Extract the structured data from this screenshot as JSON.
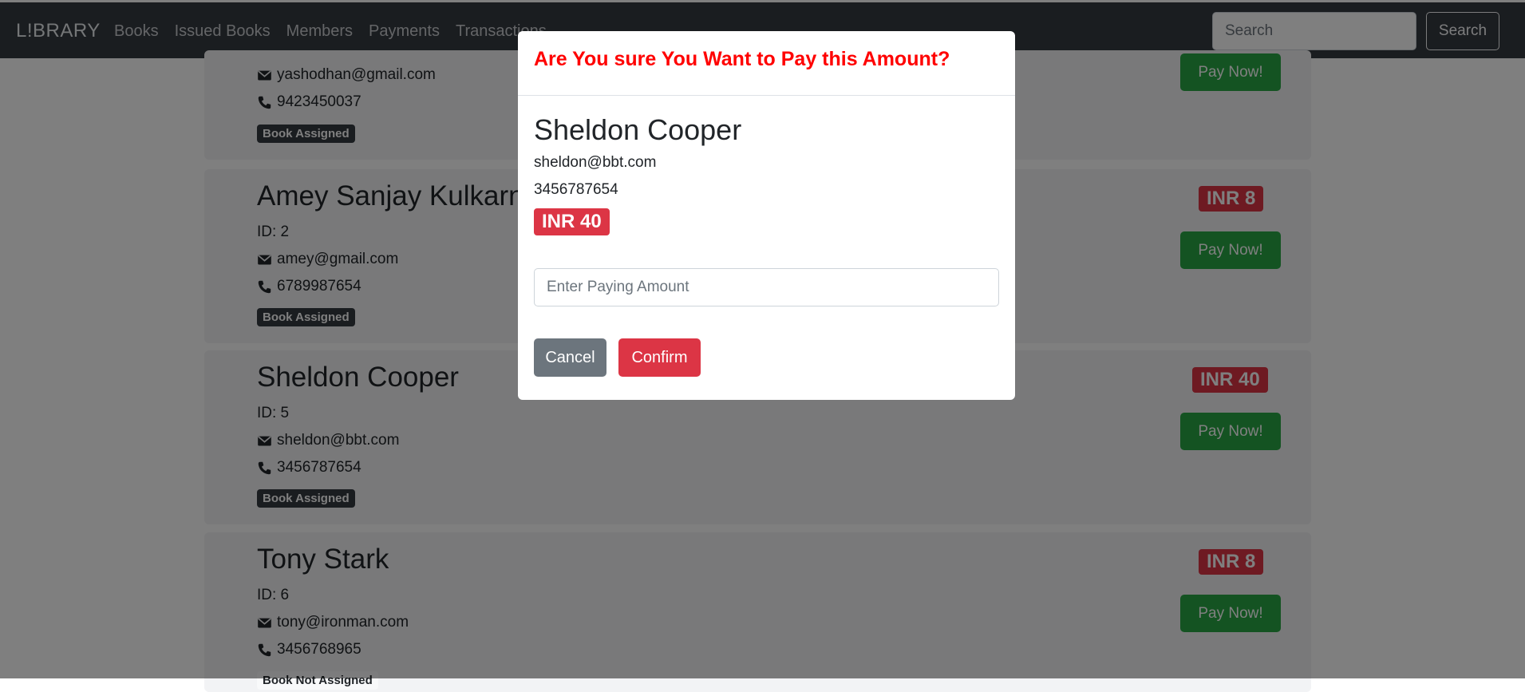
{
  "navbar": {
    "brand": "L!BRARY",
    "links": [
      "Books",
      "Issued Books",
      "Members",
      "Payments",
      "Transactions"
    ],
    "search_placeholder": "Search",
    "search_button": "Search"
  },
  "members": [
    {
      "name": "",
      "id": "",
      "email": "yashodhan@gmail.com",
      "phone": "9423450037",
      "status": "Book Assigned",
      "amount": "",
      "pay_label": "Pay Now!"
    },
    {
      "name": "Amey Sanjay Kulkarn",
      "id": "ID: 2",
      "email": "amey@gmail.com",
      "phone": "6789987654",
      "status": "Book Assigned",
      "amount": "INR 8",
      "pay_label": "Pay Now!"
    },
    {
      "name": "Sheldon Cooper",
      "id": "ID: 5",
      "email": "sheldon@bbt.com",
      "phone": "3456787654",
      "status": "Book Assigned",
      "amount": "INR 40",
      "pay_label": "Pay Now!"
    },
    {
      "name": "Tony Stark",
      "id": "ID: 6",
      "email": "tony@ironman.com",
      "phone": "3456768965",
      "status": "Book Not Assigned",
      "amount": "INR 8",
      "pay_label": "Pay Now!"
    }
  ],
  "modal": {
    "title": "Are You sure You Want to Pay this Amount?",
    "name": "Sheldon Cooper",
    "email": "sheldon@bbt.com",
    "phone": "3456787654",
    "amount": "INR 40",
    "input_placeholder": "Enter Paying Amount",
    "cancel_label": "Cancel",
    "confirm_label": "Confirm"
  },
  "icons": {
    "email": "envelope-icon",
    "phone": "phone-icon"
  },
  "colors": {
    "navbar": "#343a40",
    "danger": "#dc3545",
    "success": "#28a745",
    "secondary": "#6c757d",
    "modal_title": "#ff0000"
  }
}
